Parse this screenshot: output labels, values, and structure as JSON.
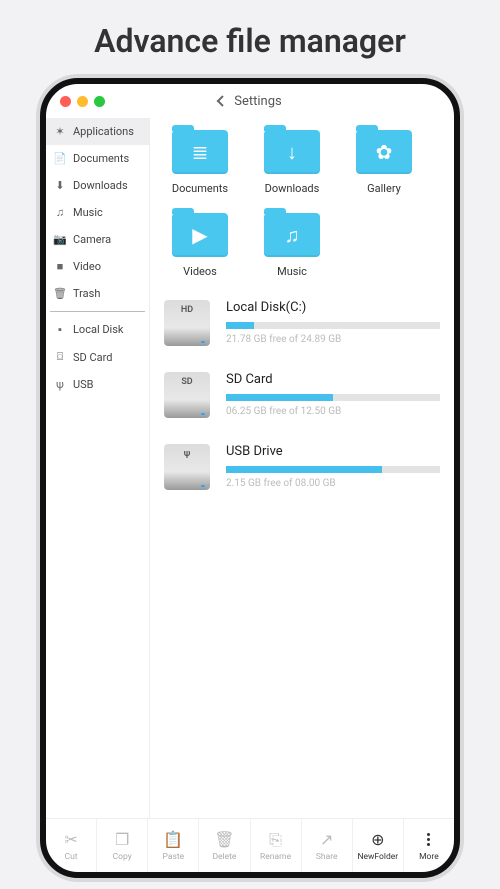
{
  "page_title": "Advance file manager",
  "window": {
    "back_title": "Settings"
  },
  "sidebar": {
    "groups": [
      [
        {
          "icon": "✶",
          "label": "Applications",
          "active": true
        },
        {
          "icon": "📄",
          "label": "Documents"
        },
        {
          "icon": "⬇",
          "label": "Downloads"
        },
        {
          "icon": "♫",
          "label": "Music"
        },
        {
          "icon": "📷",
          "label": "Camera"
        },
        {
          "icon": "■",
          "label": "Video"
        },
        {
          "icon": "🗑",
          "label": "Trash"
        }
      ],
      [
        {
          "icon": "▪",
          "label": "Local Disk"
        },
        {
          "icon": "⌼",
          "label": "SD Card"
        },
        {
          "icon": "ψ",
          "label": "USB"
        }
      ]
    ]
  },
  "folders": [
    {
      "label": "Documents",
      "glyph": "≣"
    },
    {
      "label": "Downloads",
      "glyph": "↓"
    },
    {
      "label": "Gallery",
      "glyph": "✿"
    },
    {
      "label": "Videos",
      "glyph": "▶"
    },
    {
      "label": "Music",
      "glyph": "♫"
    }
  ],
  "storage": [
    {
      "badge": "HD",
      "name": "Local Disk(C:)",
      "free_text": "21.78 GB free of 24.89 GB",
      "used_pct": 13
    },
    {
      "badge": "SD",
      "name": "SD Card",
      "free_text": "06.25 GB free of 12.50 GB",
      "used_pct": 50
    },
    {
      "badge": "ψ",
      "name": "USB Drive",
      "free_text": "2.15 GB free of 08.00 GB",
      "used_pct": 73
    }
  ],
  "bottom": [
    {
      "icon": "✂",
      "label": "Cut"
    },
    {
      "icon": "❐",
      "label": "Copy"
    },
    {
      "icon": "📋",
      "label": "Paste"
    },
    {
      "icon": "🗑",
      "label": "Delete"
    },
    {
      "icon": "⎘",
      "label": "Rename"
    },
    {
      "icon": "↗",
      "label": "Share"
    },
    {
      "icon": "⊕",
      "label": "NewFolder",
      "dark": true
    },
    {
      "icon": "dots",
      "label": "More",
      "dark": true
    }
  ]
}
